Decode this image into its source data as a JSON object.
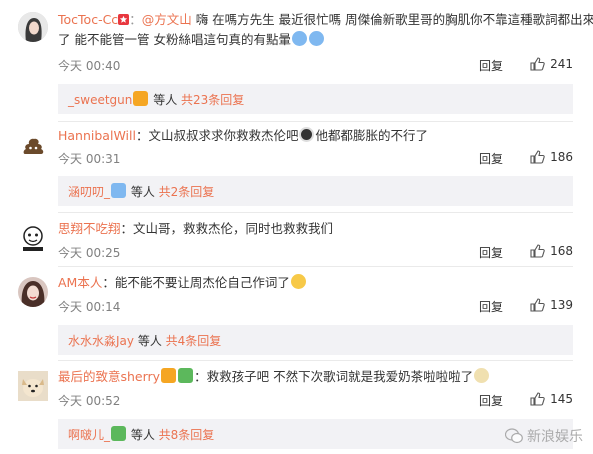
{
  "comments": [
    {
      "user": "TocToc-Cc",
      "mention": "@方文山",
      "text": "  嗨 在嗎方先生 最近很忙嗎 周傑倫新歌里哥的胸肌你不靠這種歌詞都出來了 能不能管一管 女粉絲唱這句真的有點暈",
      "text_line2": "了 能不能管一管 女粉絲唱這句真的有點暈",
      "time": "今天 00:40",
      "reply": "回复",
      "likes": "241",
      "sub_user": "_sweetgun",
      "sub_mid": " 等人 ",
      "sub_count": "共23条回复"
    },
    {
      "user": "HannibalWill",
      "text": "：文山叔叔求求你救救杰伦吧",
      "text_after": "他都都膨胀的不行了",
      "time": "今天 00:31",
      "reply": "回复",
      "likes": "186",
      "sub_user": "涵叨叨_",
      "sub_mid": " 等人 ",
      "sub_count": "共2条回复"
    },
    {
      "user": "思翔不吃翔",
      "text": "：文山哥，救救杰伦，同时也救救我们",
      "time": "今天 00:25",
      "reply": "回复",
      "likes": "168"
    },
    {
      "user": "AM本人",
      "text": "：能不能不要让周杰伦自己作词了",
      "time": "今天 00:14",
      "reply": "回复",
      "likes": "139",
      "sub_user": "水水水淼Jay",
      "sub_mid": " 等人 ",
      "sub_count": "共4条回复"
    },
    {
      "user": "最后的致意sherry",
      "text": "：救救孩子吧  不然下次歌词就是我爱奶茶啦啦啦了",
      "time": "今天 00:52",
      "reply": "回复",
      "likes": "145",
      "sub_user": "啊啵儿_",
      "sub_mid": " 等人 ",
      "sub_count": "共8条回复"
    }
  ],
  "watermark": "新浪娱乐",
  "colors": {
    "accent": "#eb7350",
    "sub_bg": "#f2f2f5",
    "meta": "#808080"
  }
}
